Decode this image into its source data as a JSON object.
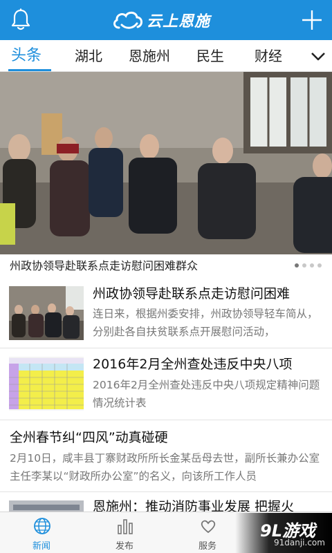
{
  "header": {
    "title": "云上恩施",
    "bell_icon": "bell-icon",
    "cloud_logo": "cloud-logo",
    "add_icon": "plus-icon",
    "background_color": "#1e8fdc"
  },
  "tabs": [
    {
      "label": "头条",
      "active": true
    },
    {
      "label": "湖北",
      "active": false
    },
    {
      "label": "恩施州",
      "active": false
    },
    {
      "label": "民生",
      "active": false
    },
    {
      "label": "财经",
      "active": false
    }
  ],
  "tabs_more_icon": "chevron-down-icon",
  "hero": {
    "caption": "州政协领导赴联系点走访慰问困难群众",
    "slide_count": 4,
    "active_slide": 1
  },
  "news": [
    {
      "title": "州政协领导赴联系点走访慰问困难",
      "summary": "连日来，根据州委安排，州政协领导轻车简从，分别赴各自扶贫联系点开展慰问活动，"
    },
    {
      "title": "2016年2月全州查处违反中央八项",
      "summary": "2016年2月全州查处违反中央八项规定精神问题情况统计表"
    },
    {
      "title": "全州春节纠“四风”动真碰硬",
      "summary": "2月10日，咸丰县丁寨财政所所长金某岳母去世，副所长兼办公室主任李某以“财政所办公室”的名义，向该所工作人员"
    },
    {
      "title": "恩施州：推动消防事业发展 把握火"
    }
  ],
  "bottom_nav": [
    {
      "label": "新闻",
      "icon": "globe-icon",
      "active": true
    },
    {
      "label": "发布",
      "icon": "bar-chart-icon",
      "active": false
    },
    {
      "label": "服务",
      "icon": "heart-hands-icon",
      "active": false
    }
  ],
  "watermark": {
    "logo": "9L游戏",
    "url": "91danji.com"
  }
}
